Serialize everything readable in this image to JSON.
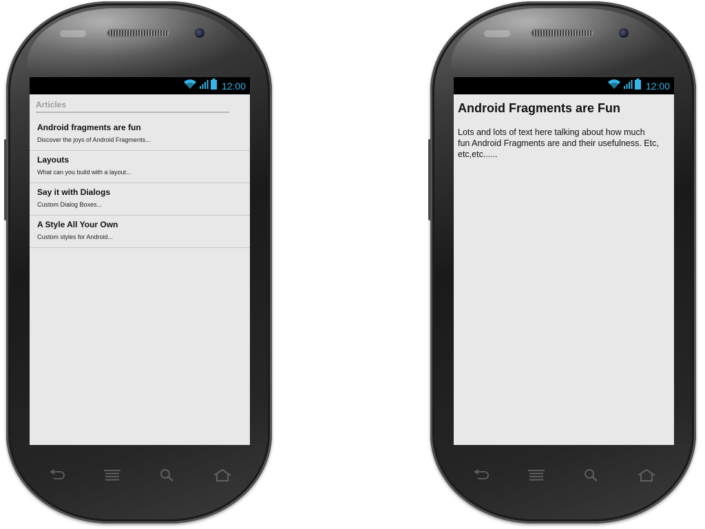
{
  "status_bar": {
    "time": "12:00"
  },
  "list_screen": {
    "section_header": "Articles",
    "articles": [
      {
        "title": "Android fragments are fun",
        "subtitle": "Discover the joys of Android Fragments..."
      },
      {
        "title": "Layouts",
        "subtitle": "What can you build with a layout..."
      },
      {
        "title": "Say it with Dialogs",
        "subtitle": "Custom Dialog Boxes..."
      },
      {
        "title": "A Style All Your Own",
        "subtitle": "Custom styles for Android..."
      }
    ]
  },
  "detail_screen": {
    "title": "Android Fragments are Fun",
    "body": "Lots and lots of text here talking about how much fun Android Fragments are and their usefulness. Etc, etc,etc......"
  },
  "colors": {
    "status_accent": "#33b5e5",
    "screen_background": "#e8e8e8",
    "status_bar_background": "#000000"
  },
  "icons": [
    "wifi-icon",
    "signal-icon",
    "battery-icon",
    "back-icon",
    "menu-icon",
    "search-icon",
    "home-icon"
  ]
}
